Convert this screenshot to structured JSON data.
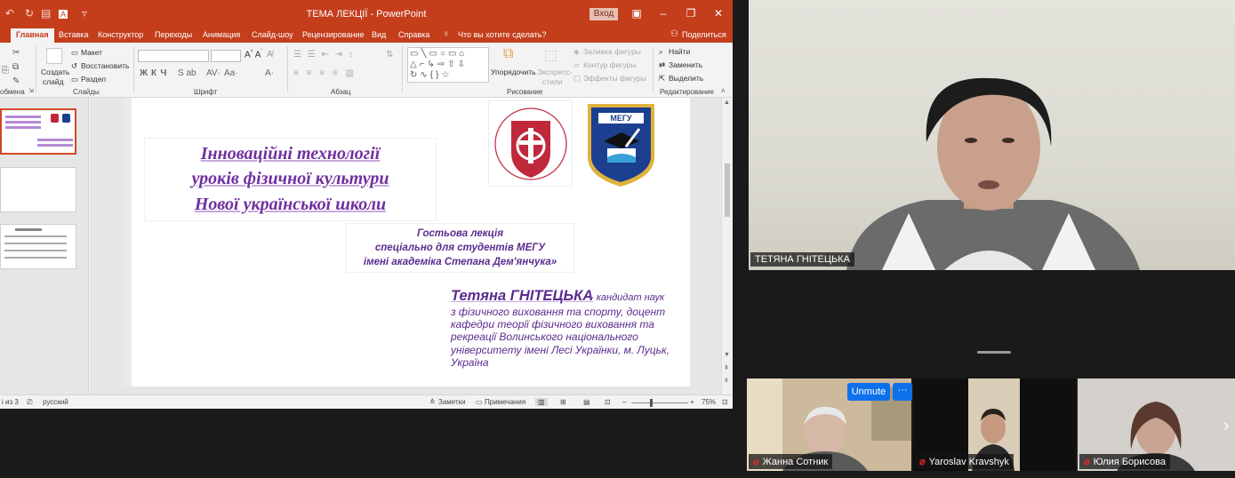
{
  "ppt": {
    "doc_title": "ТЕМА ЛЕКЦІЇ  -  PowerPoint",
    "login_button": "Вход",
    "tabs": [
      "Главная",
      "Вставка",
      "Конструктор",
      "Переходы",
      "Анимация",
      "Слайд-шоу",
      "Рецензирование",
      "Вид",
      "Справка"
    ],
    "tell_me": "Что вы хотите сделать?",
    "share": "Поделиться",
    "ribbon": {
      "clipboard_label": "обмена",
      "new_slide": "Создать",
      "new_slide_2": "слайд",
      "layout": "Макет",
      "reset": "Восстановить",
      "section": "Раздел",
      "slides_label": "Слайды",
      "font_label": "Шрифт",
      "paragraph_label": "Абзац",
      "arrange": "Упорядочить",
      "quick_styles": "Экспресс-",
      "quick_styles_2": "стили",
      "shape_fill": "Заливка фигуры",
      "shape_outline": "Контур фигуры",
      "shape_effects": "Эффекты фигуры",
      "drawing_label": "Рисование",
      "find": "Найти",
      "replace": "Заменить",
      "select": "Выделить",
      "editing_label": "Редактирование"
    },
    "status": {
      "slide_of": "і из 3",
      "language": "русский",
      "notes": "Заметки",
      "comments": "Примечания",
      "zoom": "75%"
    },
    "slide": {
      "title_lines": [
        "Інноваційні технології",
        "уроків фізичної культури",
        "Нової української школи"
      ],
      "guest_lines": [
        "Гостьова лекція",
        "спеціально для студентів МЕГУ",
        "імені академіка Степана Дем'янчука»"
      ],
      "author_name": "Тетяна ГНІТЕЦЬКА",
      "author_role": "- кандидат наук",
      "author_lines": [
        "з фізичного виховання та спорту, доцент",
        "кафедри теорії фізичного виховання та",
        "рекреації Волинського національного",
        "університету імені Лесі Українки, м. Луцьк,",
        "Україна"
      ],
      "logo_vnu_text": "ВОЛИНСЬКИЙ НАЦІОНАЛЬНИЙ УНІВЕРСИТЕТ",
      "logo_meg_text": "МЕГУ"
    },
    "colors": {
      "accent": "#c43e1c",
      "slide_text": "#5b2c8e"
    }
  },
  "zoom": {
    "speaker_name": "ТЕТЯНА ГНІТЕЦЬКА",
    "unmute": "Unmute",
    "more": "···",
    "participants": [
      "Жанна Сотник",
      "Yaroslav Kravshyk",
      "Юлия Борисова"
    ],
    "mic_icon": "muted-mic-icon"
  }
}
